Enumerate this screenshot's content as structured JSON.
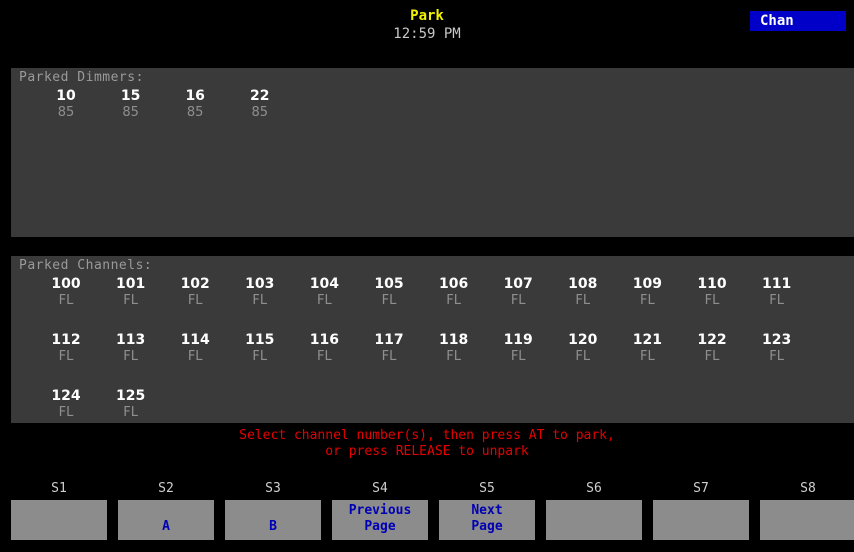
{
  "header": {
    "title": "Park",
    "time": "12:59 PM",
    "mode": "Chan"
  },
  "dimmers": {
    "label": "Parked Dimmers:",
    "items": [
      {
        "num": "10",
        "level": "85"
      },
      {
        "num": "15",
        "level": "85"
      },
      {
        "num": "16",
        "level": "85"
      },
      {
        "num": "22",
        "level": "85"
      }
    ]
  },
  "channels": {
    "label": "Parked Channels:",
    "items": [
      {
        "num": "100",
        "level": "FL"
      },
      {
        "num": "101",
        "level": "FL"
      },
      {
        "num": "102",
        "level": "FL"
      },
      {
        "num": "103",
        "level": "FL"
      },
      {
        "num": "104",
        "level": "FL"
      },
      {
        "num": "105",
        "level": "FL"
      },
      {
        "num": "106",
        "level": "FL"
      },
      {
        "num": "107",
        "level": "FL"
      },
      {
        "num": "108",
        "level": "FL"
      },
      {
        "num": "109",
        "level": "FL"
      },
      {
        "num": "110",
        "level": "FL"
      },
      {
        "num": "111",
        "level": "FL"
      },
      {
        "num": "112",
        "level": "FL"
      },
      {
        "num": "113",
        "level": "FL"
      },
      {
        "num": "114",
        "level": "FL"
      },
      {
        "num": "115",
        "level": "FL"
      },
      {
        "num": "116",
        "level": "FL"
      },
      {
        "num": "117",
        "level": "FL"
      },
      {
        "num": "118",
        "level": "FL"
      },
      {
        "num": "119",
        "level": "FL"
      },
      {
        "num": "120",
        "level": "FL"
      },
      {
        "num": "121",
        "level": "FL"
      },
      {
        "num": "122",
        "level": "FL"
      },
      {
        "num": "123",
        "level": "FL"
      },
      {
        "num": "124",
        "level": "FL"
      },
      {
        "num": "125",
        "level": "FL"
      }
    ]
  },
  "prompt": {
    "line1": "Select channel number(s), then press AT to park,",
    "line2": "or press RELEASE to unpark"
  },
  "softkeys": [
    {
      "id": "S1",
      "line1": "",
      "line2": ""
    },
    {
      "id": "S2",
      "line1": "",
      "line2": "A"
    },
    {
      "id": "S3",
      "line1": "",
      "line2": "B"
    },
    {
      "id": "S4",
      "line1": "Previous",
      "line2": "Page"
    },
    {
      "id": "S5",
      "line1": "Next",
      "line2": "Page"
    },
    {
      "id": "S6",
      "line1": "",
      "line2": ""
    },
    {
      "id": "S7",
      "line1": "",
      "line2": ""
    },
    {
      "id": "S8",
      "line1": "",
      "line2": ""
    }
  ],
  "colors": {
    "title": "#f2f200",
    "mode_bg": "#0000c8",
    "panel_bg": "#3a3a3a",
    "prompt": "#e60000",
    "softkey_bg": "#8c8c8c",
    "softkey_text": "#0000b4"
  }
}
